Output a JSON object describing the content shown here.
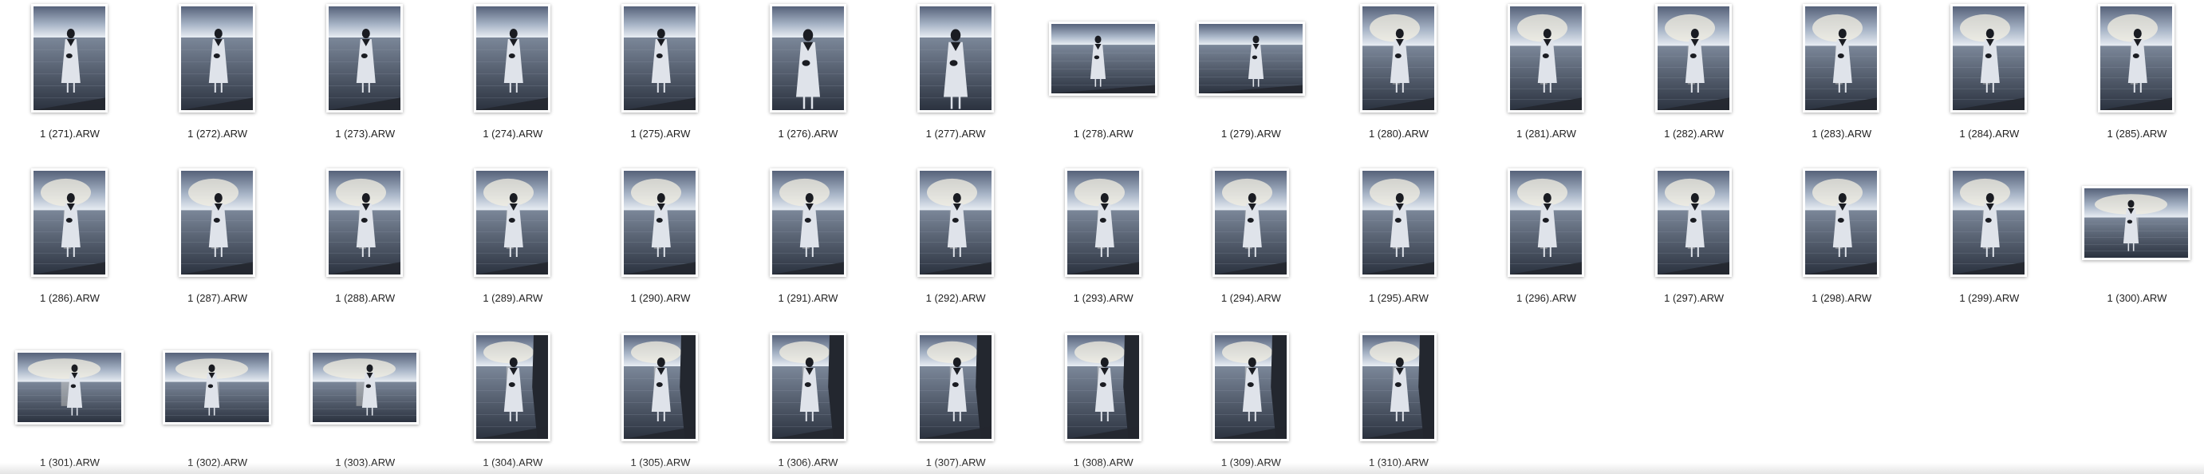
{
  "colors": {
    "sky_light": "#e8edf3",
    "sky_mid": "#a9b6c8",
    "sky_dark": "#56627a",
    "water_top": "#7b8799",
    "water_bottom": "#2b323f",
    "sun_glare": "#f3efe2",
    "rock": "#23272f",
    "figure_dress": "#dfe3ea",
    "figure_hair": "#1a1c22"
  },
  "files": [
    {
      "name": "1 (271).ARW",
      "orientation": "portrait",
      "variant": "sea"
    },
    {
      "name": "1 (272).ARW",
      "orientation": "portrait",
      "variant": "sea"
    },
    {
      "name": "1 (273).ARW",
      "orientation": "portrait",
      "variant": "sea"
    },
    {
      "name": "1 (274).ARW",
      "orientation": "portrait",
      "variant": "sea"
    },
    {
      "name": "1 (275).ARW",
      "orientation": "portrait",
      "variant": "sea"
    },
    {
      "name": "1 (276).ARW",
      "orientation": "portrait",
      "variant": "close"
    },
    {
      "name": "1 (277).ARW",
      "orientation": "portrait",
      "variant": "close"
    },
    {
      "name": "1 (278).ARW",
      "orientation": "landscape",
      "variant": "sea"
    },
    {
      "name": "1 (279).ARW",
      "orientation": "landscape",
      "variant": "sea"
    },
    {
      "name": "1 (280).ARW",
      "orientation": "portrait",
      "variant": "clouds"
    },
    {
      "name": "1 (281).ARW",
      "orientation": "portrait",
      "variant": "clouds"
    },
    {
      "name": "1 (282).ARW",
      "orientation": "portrait",
      "variant": "clouds"
    },
    {
      "name": "1 (283).ARW",
      "orientation": "portrait",
      "variant": "clouds"
    },
    {
      "name": "1 (284).ARW",
      "orientation": "portrait",
      "variant": "clouds"
    },
    {
      "name": "1 (285).ARW",
      "orientation": "portrait",
      "variant": "clouds"
    },
    {
      "name": "1 (286).ARW",
      "orientation": "portrait",
      "variant": "clouds"
    },
    {
      "name": "1 (287).ARW",
      "orientation": "portrait",
      "variant": "clouds"
    },
    {
      "name": "1 (288).ARW",
      "orientation": "portrait",
      "variant": "clouds"
    },
    {
      "name": "1 (289).ARW",
      "orientation": "portrait",
      "variant": "clouds"
    },
    {
      "name": "1 (290).ARW",
      "orientation": "portrait",
      "variant": "clouds"
    },
    {
      "name": "1 (291).ARW",
      "orientation": "portrait",
      "variant": "clouds"
    },
    {
      "name": "1 (292).ARW",
      "orientation": "portrait",
      "variant": "clouds"
    },
    {
      "name": "1 (293).ARW",
      "orientation": "portrait",
      "variant": "clouds"
    },
    {
      "name": "1 (294).ARW",
      "orientation": "portrait",
      "variant": "clouds"
    },
    {
      "name": "1 (295).ARW",
      "orientation": "portrait",
      "variant": "clouds"
    },
    {
      "name": "1 (296).ARW",
      "orientation": "portrait",
      "variant": "clouds"
    },
    {
      "name": "1 (297).ARW",
      "orientation": "portrait",
      "variant": "clouds"
    },
    {
      "name": "1 (298).ARW",
      "orientation": "portrait",
      "variant": "clouds"
    },
    {
      "name": "1 (299).ARW",
      "orientation": "portrait",
      "variant": "clouds"
    },
    {
      "name": "1 (300).ARW",
      "orientation": "landscape",
      "variant": "sunset"
    },
    {
      "name": "1 (301).ARW",
      "orientation": "landscape",
      "variant": "sunset"
    },
    {
      "name": "1 (302).ARW",
      "orientation": "landscape",
      "variant": "sunset"
    },
    {
      "name": "1 (303).ARW",
      "orientation": "landscape",
      "variant": "sunset"
    },
    {
      "name": "1 (304).ARW",
      "orientation": "portrait",
      "variant": "cliff"
    },
    {
      "name": "1 (305).ARW",
      "orientation": "portrait",
      "variant": "cliff"
    },
    {
      "name": "1 (306).ARW",
      "orientation": "portrait",
      "variant": "cliff"
    },
    {
      "name": "1 (307).ARW",
      "orientation": "portrait",
      "variant": "cliff"
    },
    {
      "name": "1 (308).ARW",
      "orientation": "portrait",
      "variant": "cliff"
    },
    {
      "name": "1 (309).ARW",
      "orientation": "portrait",
      "variant": "cliff"
    },
    {
      "name": "1 (310).ARW",
      "orientation": "portrait",
      "variant": "cliff"
    }
  ]
}
